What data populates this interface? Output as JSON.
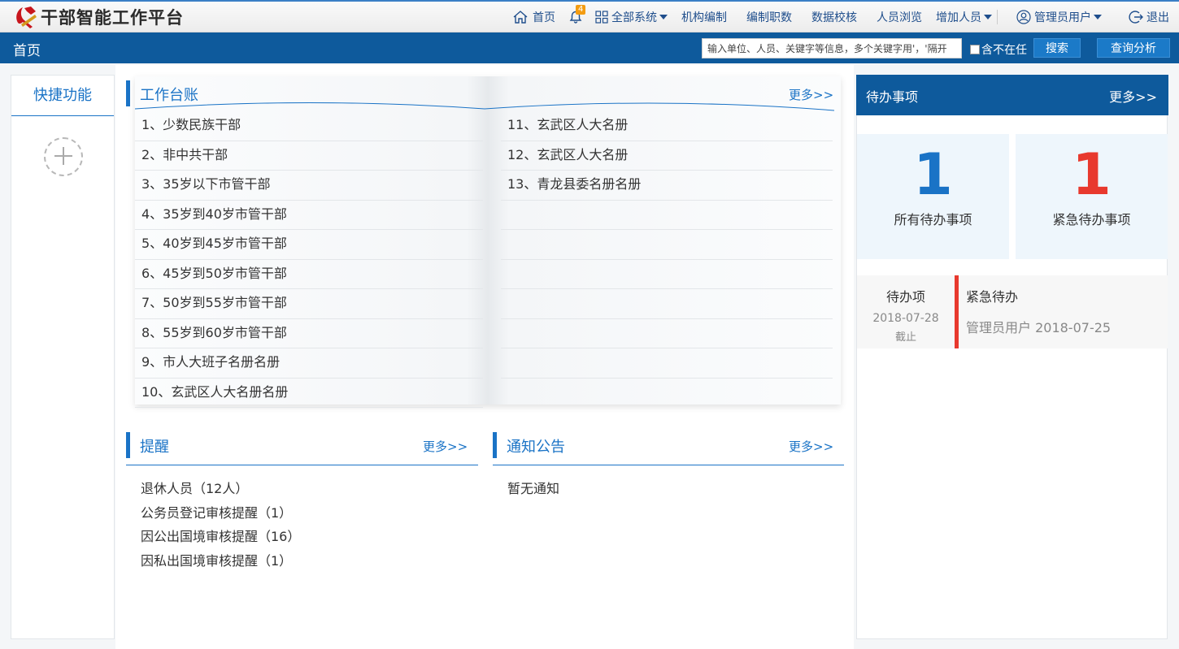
{
  "app": {
    "title": "干部智能工作平台"
  },
  "nav": {
    "home": "首页",
    "bell_count": "4",
    "all_systems": "全部系统",
    "org": "机构编制",
    "staffing": "编制职数",
    "validate": "数据校核",
    "browse": "人员浏览",
    "add_person": "增加人员",
    "user": "管理员用户",
    "logout": "退出"
  },
  "bar": {
    "page_title": "首页",
    "search_placeholder": "输入单位、人员、关键字等信息，多个关键字用'，'隔开",
    "checkbox_label": "含不在任",
    "search_btn": "搜索",
    "analyze_btn": "查询分析"
  },
  "sidebar": {
    "title": "快捷功能"
  },
  "ledger": {
    "title": "工作台账",
    "more": "更多>>",
    "left": [
      "1、少数民族干部",
      "2、非中共干部",
      "3、35岁以下市管干部",
      "4、35岁到40岁市管干部",
      "5、40岁到45岁市管干部",
      "6、45岁到50岁市管干部",
      "7、50岁到55岁市管干部",
      "8、55岁到60岁市管干部",
      "9、市人大班子名册名册",
      "10、玄武区人大名册名册"
    ],
    "right": [
      "11、玄武区人大名册",
      "12、玄武区人大名册",
      "13、青龙县委名册名册"
    ]
  },
  "reminders": {
    "title": "提醒",
    "more": "更多>>",
    "items": [
      "退休人员（12人）",
      "公务员登记审核提醒（1）",
      "因公出国境审核提醒（16）",
      "因私出国境审核提醒（1）"
    ]
  },
  "notices": {
    "title": "通知公告",
    "more": "更多>>",
    "items": [
      "暂无通知"
    ]
  },
  "todo": {
    "title": "待办事项",
    "more": "更多>>",
    "all_count": "1",
    "all_label": "所有待办事项",
    "urgent_count": "1",
    "urgent_label": "紧急待办事项",
    "item": {
      "type": "待办项",
      "deadline": "2018-07-28",
      "deadline_label": "截止",
      "title": "紧急待办",
      "meta": "管理员用户 2018-07-25"
    }
  },
  "colors": {
    "accent": "#1a73c6",
    "header": "#0e5a9c",
    "urgent": "#e8392e"
  }
}
